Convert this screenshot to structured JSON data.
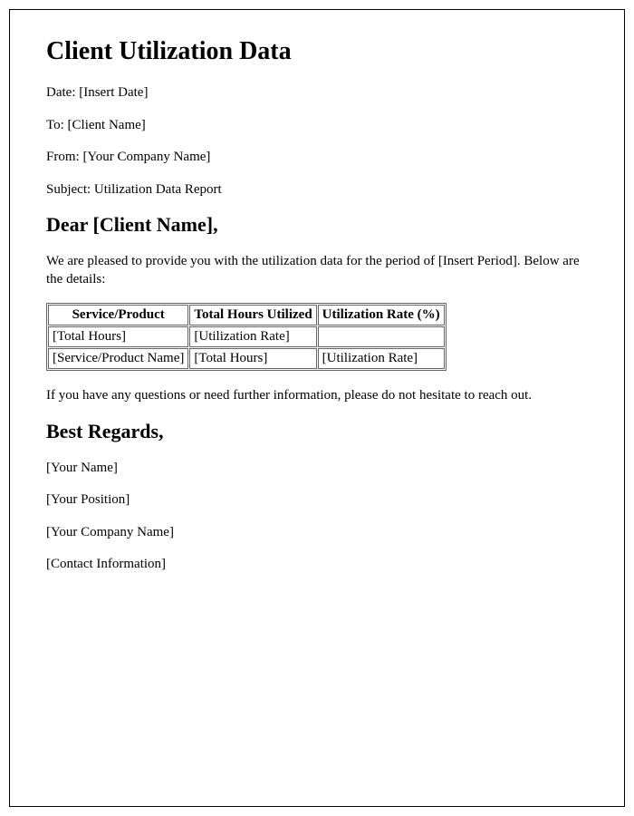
{
  "title": "Client Utilization Data",
  "header": {
    "date_label": "Date: ",
    "date_value": "[Insert Date]",
    "to_label": "To: ",
    "to_value": "[Client Name]",
    "from_label": "From: ",
    "from_value": "[Your Company Name]",
    "subject_label": "Subject: ",
    "subject_value": "Utilization Data Report"
  },
  "salutation": "Dear [Client Name],",
  "intro": "We are pleased to provide you with the utilization data for the period of [Insert Period]. Below are the details:",
  "table": {
    "headers": {
      "col1": "Service/Product",
      "col2": "Total Hours Utilized",
      "col3": "Utilization Rate (%)"
    },
    "rows": [
      {
        "col1": "[Total Hours]",
        "col2": "[Utilization Rate]",
        "col3": ""
      },
      {
        "col1": "[Service/Product Name]",
        "col2": "[Total Hours]",
        "col3": "[Utilization Rate]"
      }
    ]
  },
  "closing_text": "If you have any questions or need further information, please do not hesitate to reach out.",
  "signoff": "Best Regards,",
  "signature": {
    "name": "[Your Name]",
    "position": "[Your Position]",
    "company": "[Your Company Name]",
    "contact": "[Contact Information]"
  }
}
